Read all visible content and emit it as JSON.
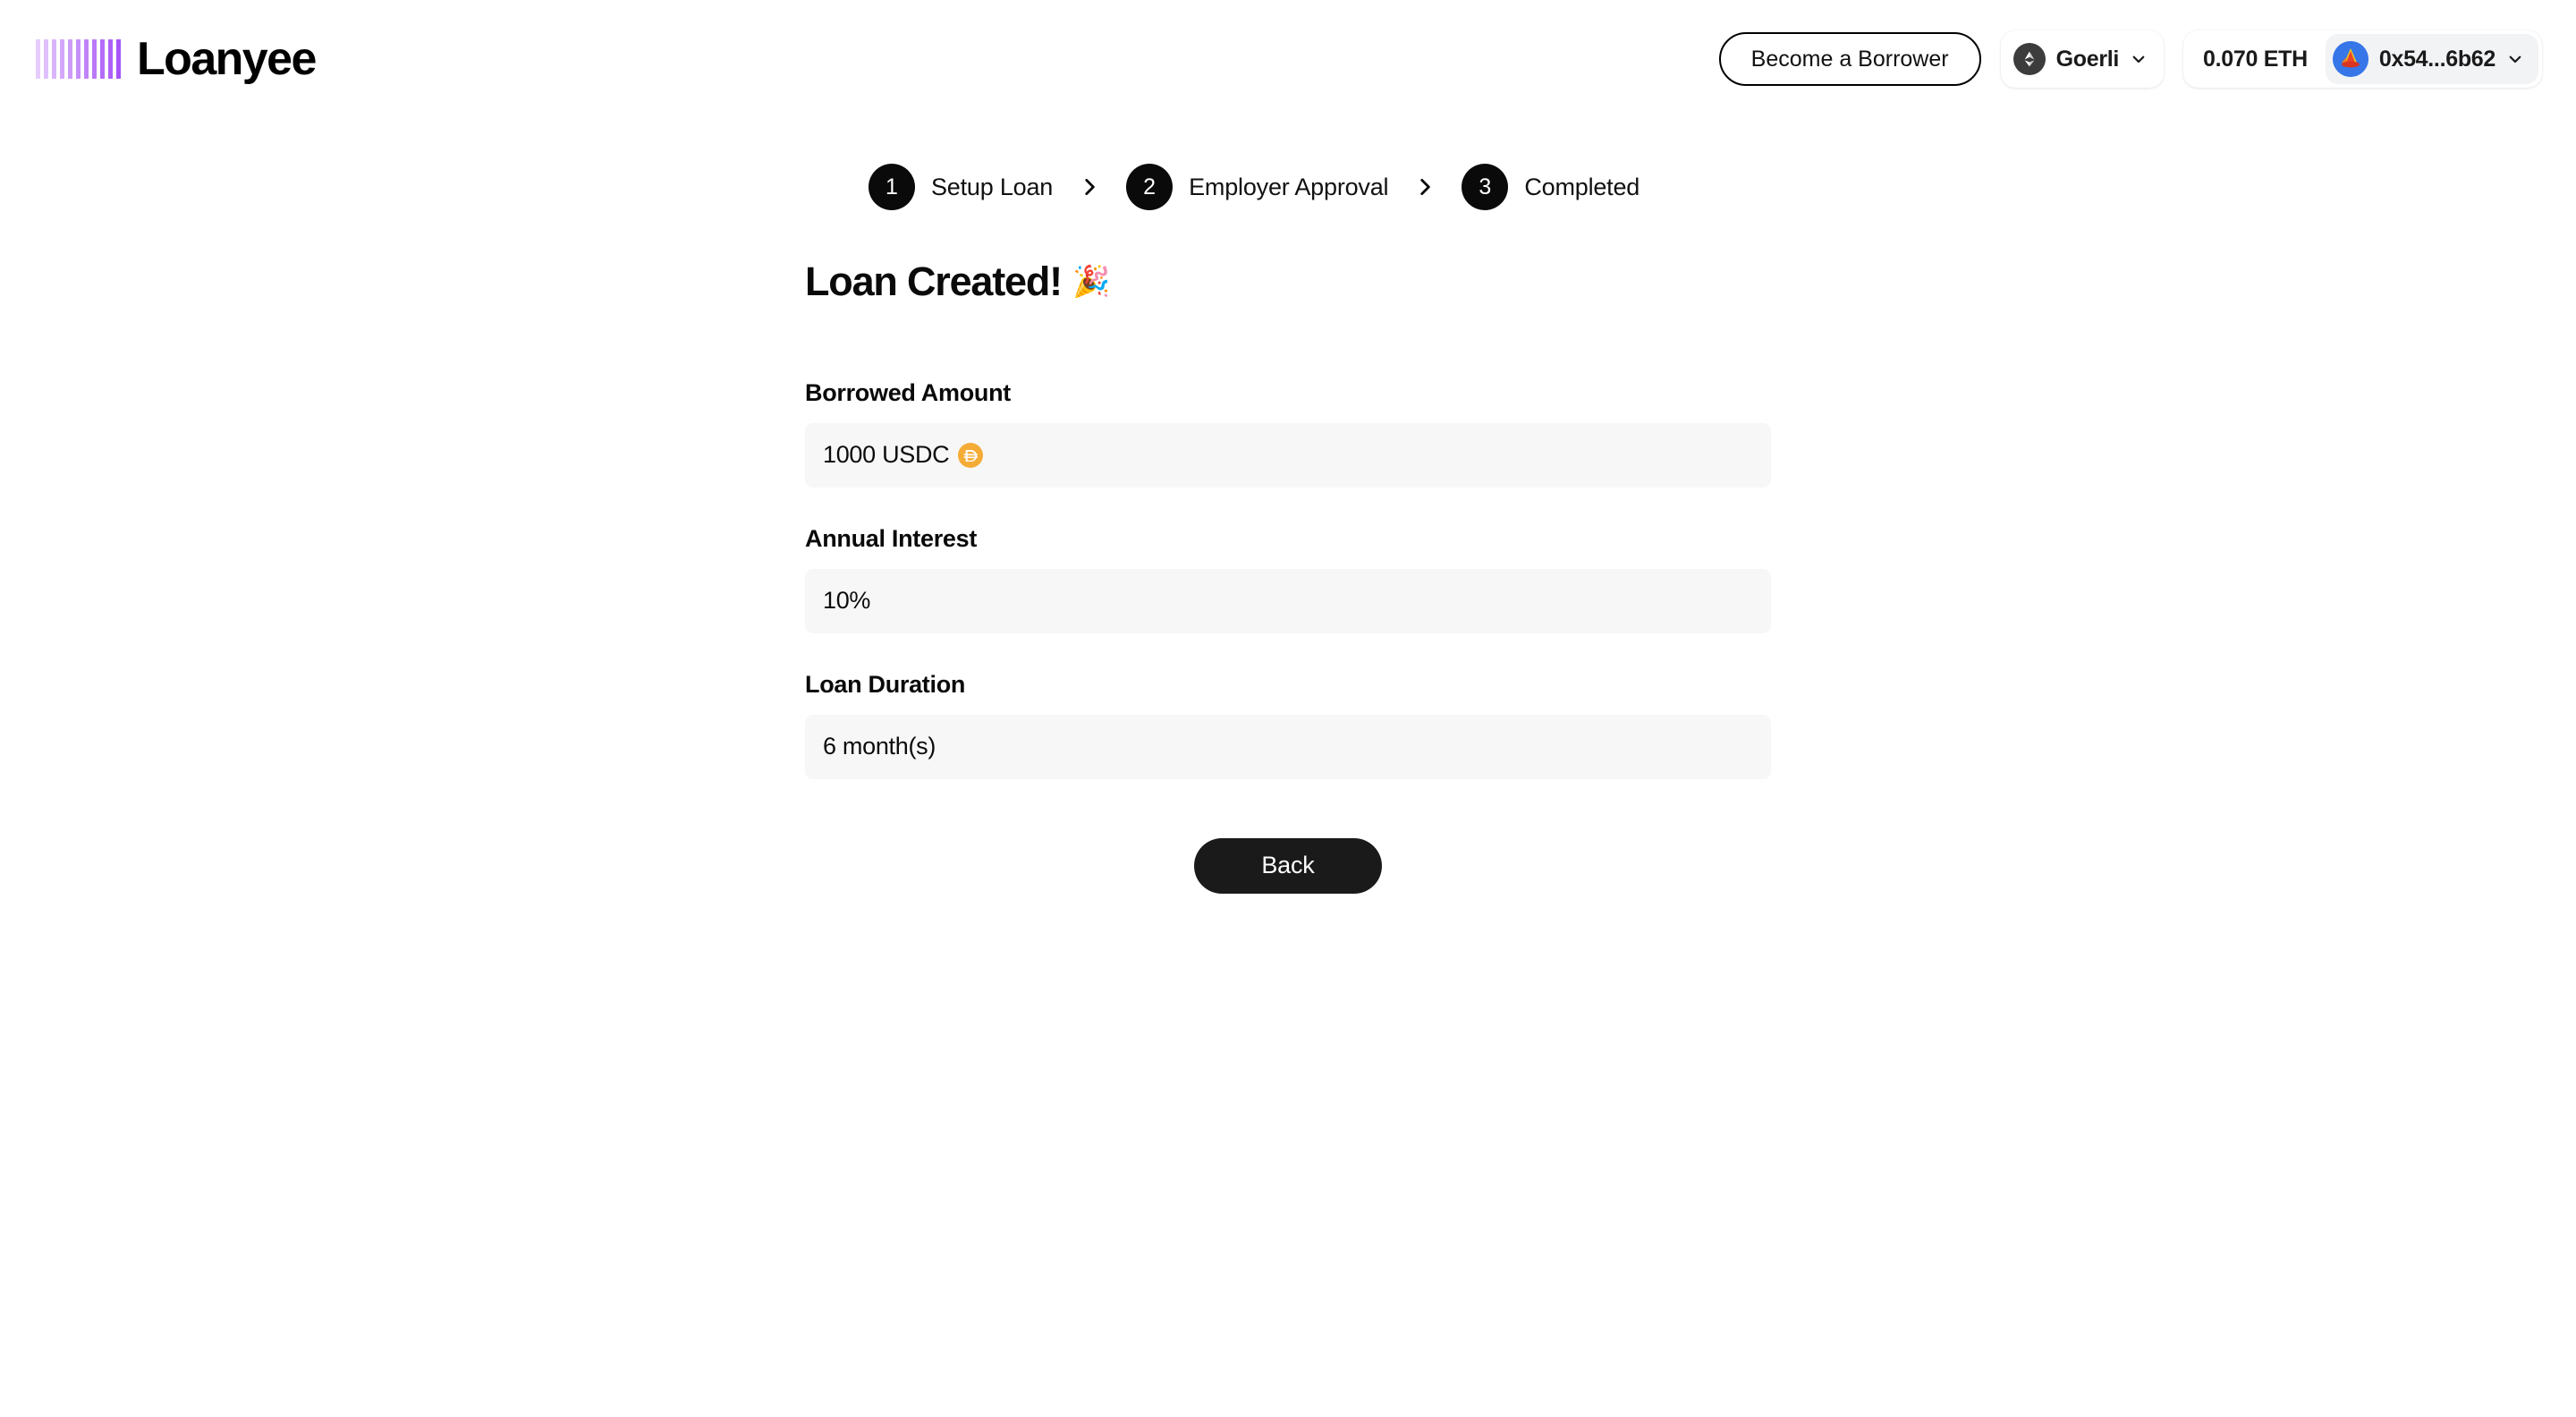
{
  "brand": {
    "name": "Loanyee",
    "logo_icon": "bars-logo-icon",
    "logo_color": "#A855F7",
    "bar_count": 11
  },
  "header": {
    "become_borrower_label": "Become a Borrower",
    "network": {
      "label": "Goerli",
      "icon": "ethereum-icon",
      "chevron_icon": "chevron-down-icon"
    },
    "account": {
      "balance": "0.070 ETH",
      "address": "0x54...6b62",
      "avatar_icon": "jazzicon-avatar",
      "avatar_color": "#3676e8",
      "chevron_icon": "chevron-down-icon"
    }
  },
  "stepper": {
    "separator_icon": "chevron-right-icon",
    "steps": [
      {
        "number": "1",
        "label": "Setup Loan"
      },
      {
        "number": "2",
        "label": "Employer Approval"
      },
      {
        "number": "3",
        "label": "Completed"
      }
    ]
  },
  "main": {
    "title": "Loan Created!",
    "title_emoji": "🎉",
    "fields": [
      {
        "label": "Borrowed Amount",
        "value": "1000 USDC",
        "icon": "dai-coin-icon",
        "icon_color": "#F5AC37"
      },
      {
        "label": "Annual Interest",
        "value": "10%",
        "icon": "",
        "icon_color": ""
      },
      {
        "label": "Loan Duration",
        "value": "6 month(s)",
        "icon": "",
        "icon_color": ""
      }
    ],
    "back_button_label": "Back"
  }
}
